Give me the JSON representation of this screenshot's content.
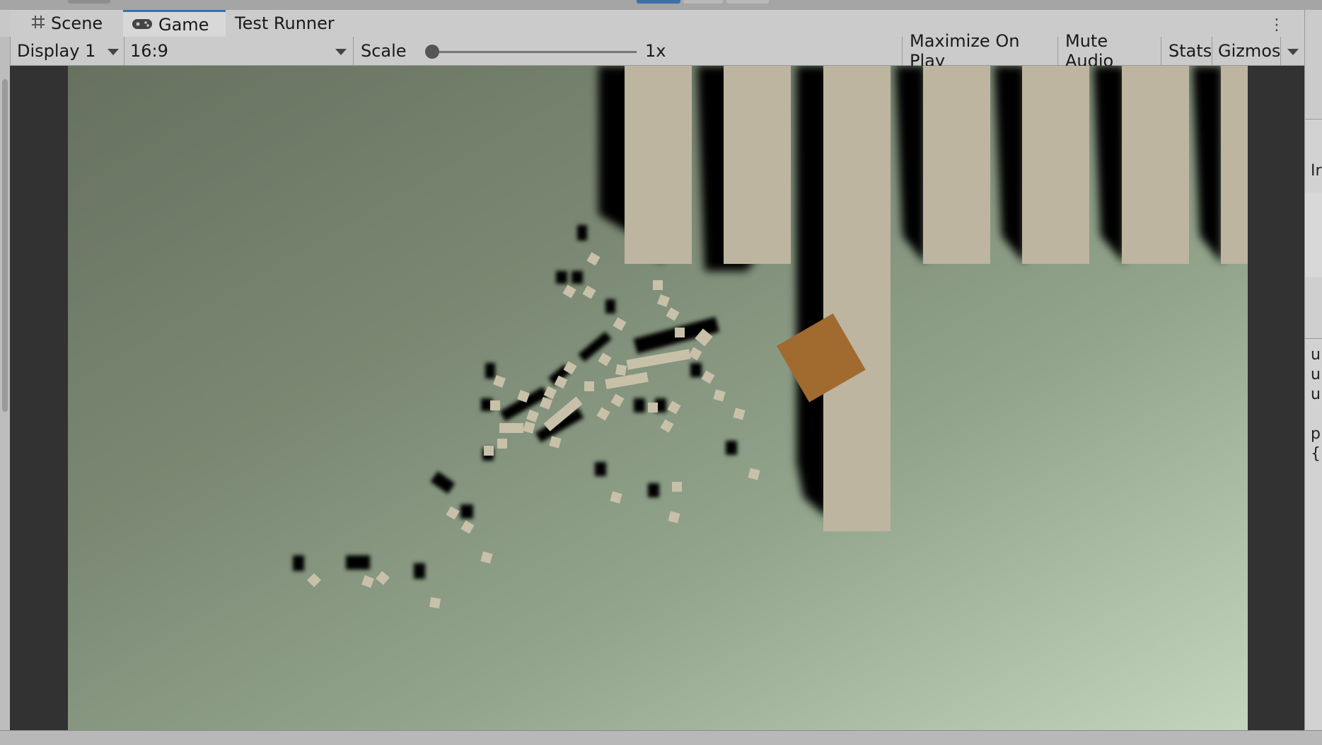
{
  "tabs": [
    {
      "label": "Scene",
      "icon": "grid-icon",
      "active": false
    },
    {
      "label": "Game",
      "icon": "gamepad-icon",
      "active": true
    },
    {
      "label": "Test Runner",
      "icon": "",
      "active": false
    }
  ],
  "toolbar": {
    "display": "Display 1",
    "aspect": "16:9",
    "scale_label": "Scale",
    "scale_value": "1x",
    "maximize_label": "Maximize On Play",
    "mute_label": "Mute Audio",
    "stats_label": "Stats",
    "gizmos_label": "Gizmos"
  },
  "right_panel": {
    "lines": [
      "u",
      "u",
      "u",
      "",
      "p",
      "{"
    ],
    "header_char": "Ir"
  },
  "colors": {
    "accent": "#3a72b0",
    "pillar": "#bdb5a0",
    "player": "#a16a2e",
    "debris": "#c8c0a9",
    "shadow": "#000000"
  }
}
